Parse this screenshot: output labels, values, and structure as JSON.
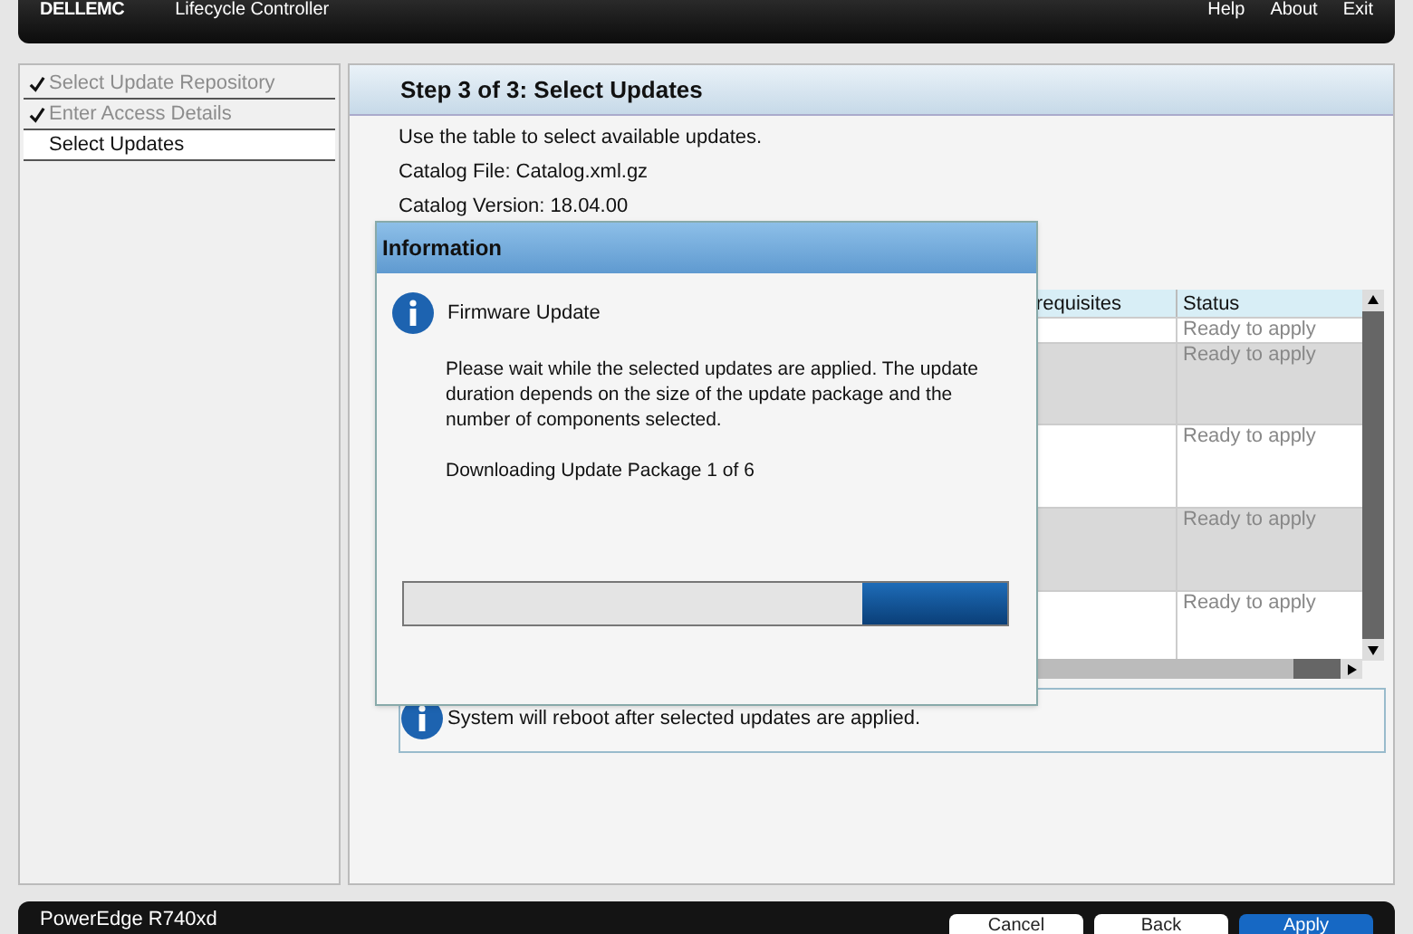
{
  "header": {
    "logo": "DELLEMC",
    "product": "Lifecycle Controller",
    "links": [
      "Help",
      "About",
      "Exit"
    ]
  },
  "steps": [
    {
      "label": "Select Update Repository",
      "done": true,
      "selected": false
    },
    {
      "label": "Enter Access Details",
      "done": true,
      "selected": false
    },
    {
      "label": "Select Updates",
      "done": false,
      "selected": true
    }
  ],
  "panel": {
    "title": "Step 3 of 3: Select Updates",
    "lines": [
      "Use the table to select available updates.",
      "Catalog File: Catalog.xml.gz",
      "Catalog Version: 18.04.00"
    ]
  },
  "table": {
    "columns": [
      "requisites",
      "Status"
    ],
    "rows": [
      {
        "status": "Ready to apply"
      },
      {
        "status": "Ready to apply"
      },
      {
        "status": "Ready to apply"
      },
      {
        "status": "Ready to apply"
      },
      {
        "status": "Ready to apply"
      }
    ]
  },
  "notice": "System will reboot after selected updates are applied.",
  "dialog": {
    "title": "Information",
    "heading": "Firmware Update",
    "message": "Please wait while the selected updates are applied. The update duration depends on the size of the update package and the number of components selected.",
    "progress_text": "Downloading Update Package 1 of 6",
    "level": 0.24
  },
  "footer": {
    "model": "PowerEdge R740xd",
    "buttons": [
      {
        "label": "Cancel",
        "primary": false
      },
      {
        "label": "Back",
        "primary": false
      },
      {
        "label": "Apply",
        "primary": true
      }
    ]
  }
}
